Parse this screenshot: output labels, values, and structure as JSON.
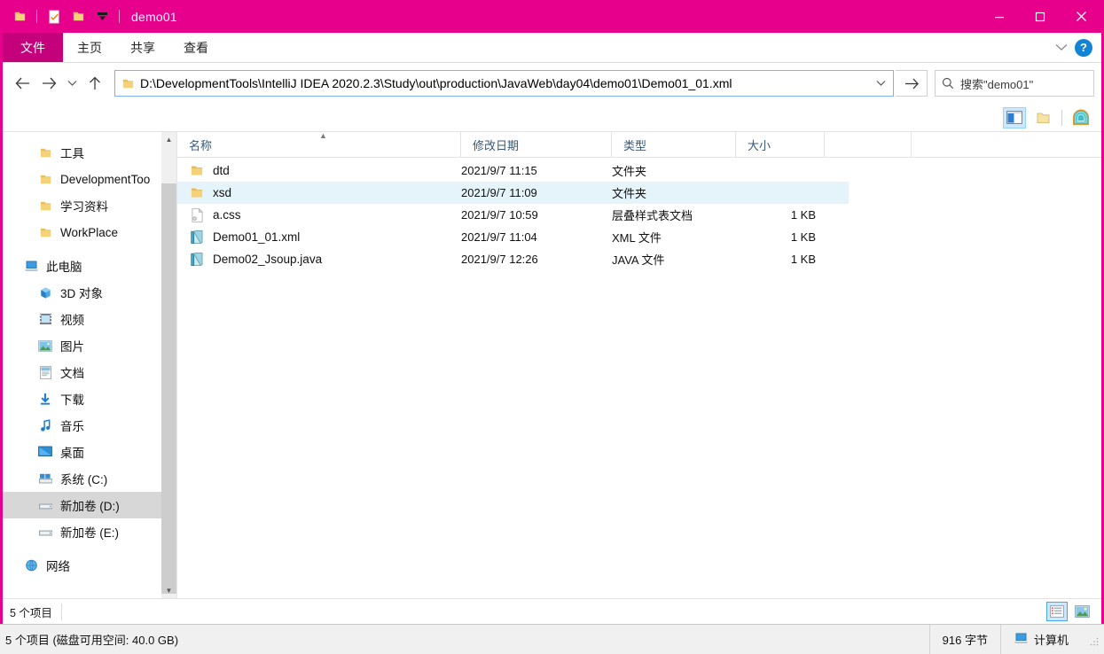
{
  "window": {
    "title": "demo01",
    "quick_access": [
      "folder-icon",
      "properties-icon",
      "new-folder-icon",
      "customize-dropdown-icon"
    ],
    "controls": {
      "minimize": "—",
      "maximize": "▢",
      "close": "✕"
    }
  },
  "ribbon": {
    "file_tab": "文件",
    "tabs": [
      "主页",
      "共享",
      "查看"
    ],
    "collapse_label": "",
    "help_label": "?"
  },
  "address": {
    "path": "D:\\DevelopmentTools\\IntelliJ IDEA 2020.2.3\\Study\\out\\production\\JavaWeb\\day04\\demo01\\Demo01_01.xml",
    "go_label": "→"
  },
  "search": {
    "placeholder": "搜索\"demo01\"",
    "value": ""
  },
  "sidebar": {
    "quick_items": [
      {
        "label": "工具",
        "icon": "folder-icon",
        "pinned": true
      },
      {
        "label": "DevelopmentToo",
        "icon": "folder-icon",
        "pinned": true
      },
      {
        "label": "学习资料",
        "icon": "folder-icon",
        "pinned": true
      },
      {
        "label": "WorkPlace",
        "icon": "folder-icon",
        "pinned": true
      }
    ],
    "this_pc": {
      "label": "此电脑",
      "icon": "this-pc-icon"
    },
    "pc_items": [
      {
        "label": "3D 对象",
        "icon": "3d-objects-icon",
        "selected": false
      },
      {
        "label": "视频",
        "icon": "videos-icon",
        "selected": false
      },
      {
        "label": "图片",
        "icon": "pictures-icon",
        "selected": false
      },
      {
        "label": "文档",
        "icon": "documents-icon",
        "selected": false
      },
      {
        "label": "下载",
        "icon": "downloads-icon",
        "selected": false
      },
      {
        "label": "音乐",
        "icon": "music-icon",
        "selected": false
      },
      {
        "label": "桌面",
        "icon": "desktop-icon",
        "selected": false
      },
      {
        "label": "系统 (C:)",
        "icon": "system-drive-icon",
        "selected": false
      },
      {
        "label": "新加卷 (D:)",
        "icon": "drive-icon",
        "selected": true
      },
      {
        "label": "新加卷 (E:)",
        "icon": "drive-icon",
        "selected": false
      }
    ],
    "network": {
      "label": "网络",
      "icon": "network-icon"
    }
  },
  "filelist": {
    "columns": [
      "名称",
      "修改日期",
      "类型",
      "大小"
    ],
    "sort_column": "名称",
    "sort_direction": "ascending",
    "rows": [
      {
        "name": "dtd",
        "date": "2021/9/7 11:15",
        "type": "文件夹",
        "size": "",
        "icon": "folder-icon",
        "highlighted": false
      },
      {
        "name": "xsd",
        "date": "2021/9/7 11:09",
        "type": "文件夹",
        "size": "",
        "icon": "folder-icon",
        "highlighted": true
      },
      {
        "name": "a.css",
        "date": "2021/9/7 10:59",
        "type": "层叠样式表文档",
        "size": "1 KB",
        "icon": "css-file-icon",
        "highlighted": false
      },
      {
        "name": "Demo01_01.xml",
        "date": "2021/9/7 11:04",
        "type": "XML 文件",
        "size": "1 KB",
        "icon": "xml-file-icon",
        "highlighted": false
      },
      {
        "name": "Demo02_Jsoup.java",
        "date": "2021/9/7 12:26",
        "type": "JAVA 文件",
        "size": "1 KB",
        "icon": "java-file-icon",
        "highlighted": false
      }
    ]
  },
  "status": {
    "item_count": "5 个项目",
    "view_details": "details-view-icon",
    "view_large": "large-icons-view-icon"
  },
  "bottombar": {
    "summary": "5 个项目 (磁盘可用空间: 40.0 GB)",
    "size": "916 字节",
    "location": "计算机"
  },
  "colors": {
    "accent": "#e6008c",
    "accent_dark": "#c4007a",
    "selection": "#cce8ff",
    "hover_row": "#e5f3fb"
  }
}
